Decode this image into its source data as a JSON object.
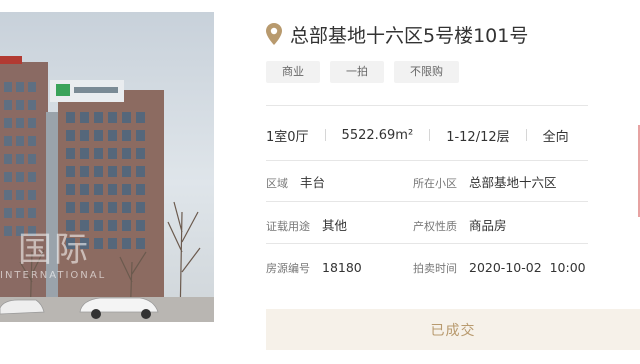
{
  "listing": {
    "title": "总部基地十六区5号楼101号",
    "tags": [
      "商业",
      "一拍",
      "不限购"
    ],
    "stats": {
      "layout": "1室0厅",
      "area": "5522.69m²",
      "floor": "1-12/12层",
      "orientation": "全向"
    },
    "details": {
      "district_label": "区域",
      "district_value": "丰台",
      "community_label": "所在小区",
      "community_value": "总部基地十六区",
      "usage_label": "证载用途",
      "usage_value": "其他",
      "property_label": "产权性质",
      "property_value": "商品房",
      "listing_no_label": "房源编号",
      "listing_no_value": "18180",
      "auction_time_label": "拍卖时间",
      "auction_time_value": "2020-10-02  10:00"
    },
    "status_button": "已成交"
  },
  "photo": {
    "watermark": "国际",
    "watermark_sub": "INTERNATIONAL"
  },
  "colors": {
    "accent_gold": "#b89a6e",
    "button_bg": "#f6f1e9",
    "tag_bg": "#f2f2f2"
  }
}
